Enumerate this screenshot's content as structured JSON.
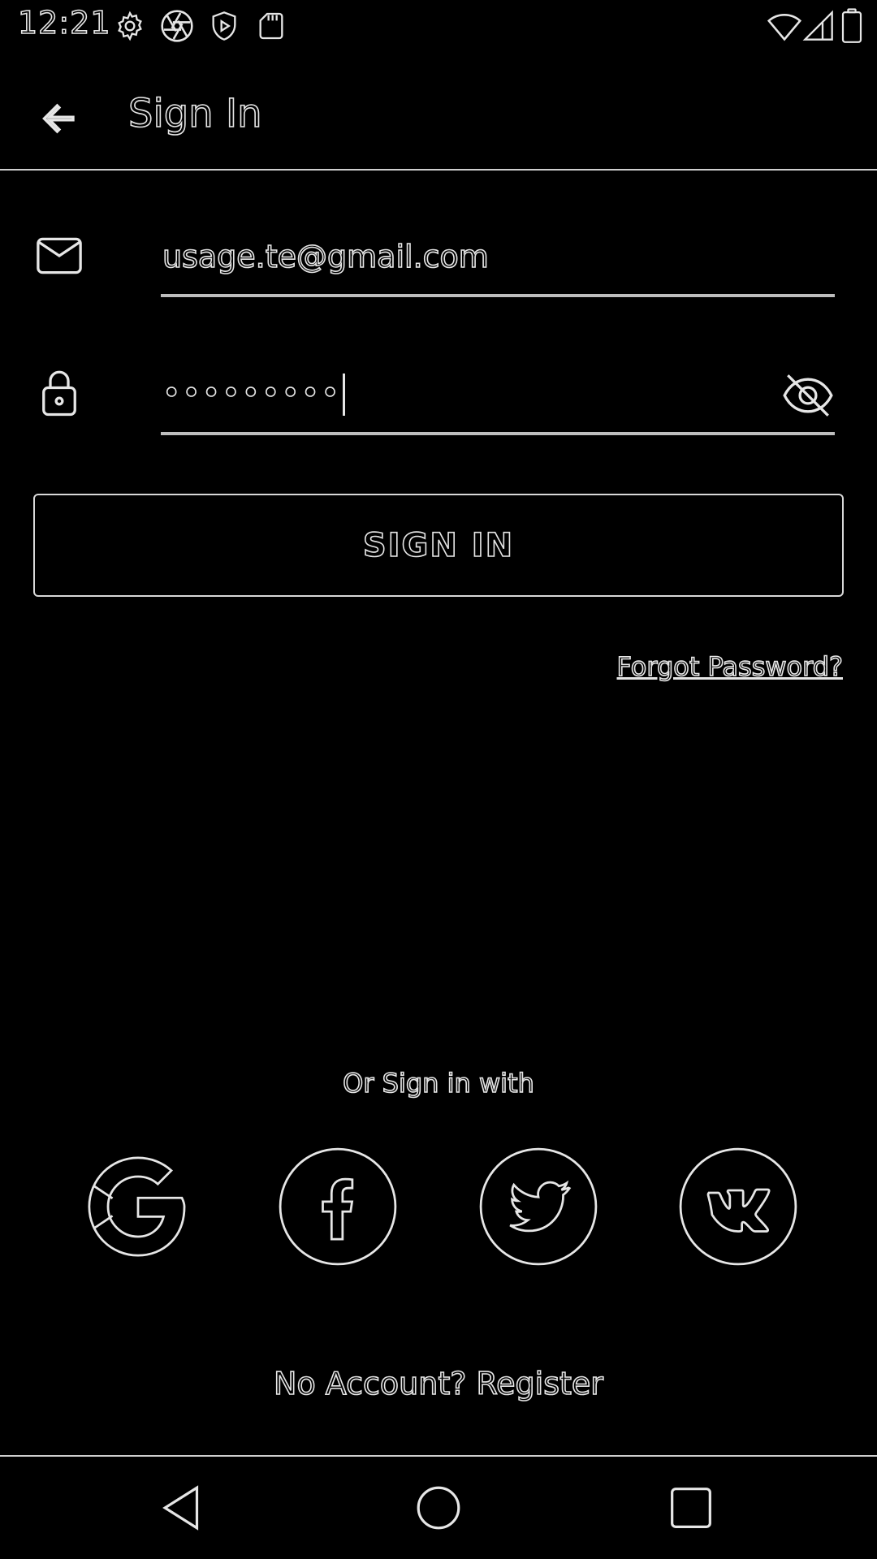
{
  "status_bar": {
    "time": "12:21",
    "icons": [
      "settings-icon",
      "aperture-icon",
      "shield-play-icon",
      "sd-card-icon",
      "wifi-icon",
      "signal-icon",
      "battery-icon"
    ]
  },
  "app_bar": {
    "title": "Sign In",
    "back_icon": "arrow-left-icon"
  },
  "form": {
    "email": {
      "icon": "mail-icon",
      "value": "usage.te@gmail.com"
    },
    "password": {
      "icon": "lock-icon",
      "value": "•••••••••",
      "toggle_icon": "eye-off-icon"
    },
    "sign_in_button": "SIGN IN",
    "forgot_password": "Forgot Password?"
  },
  "social": {
    "label": "Or Sign in with",
    "providers": [
      "google-icon",
      "facebook-icon",
      "twitter-icon",
      "vk-icon"
    ]
  },
  "register": {
    "text": "No Account? Register"
  },
  "nav_bar": {
    "buttons": [
      "nav-back-icon",
      "nav-home-icon",
      "nav-recents-icon"
    ]
  },
  "colors": {
    "background": "#000000",
    "outline": "#e6e6e6",
    "divider": "#cfcfcf"
  }
}
